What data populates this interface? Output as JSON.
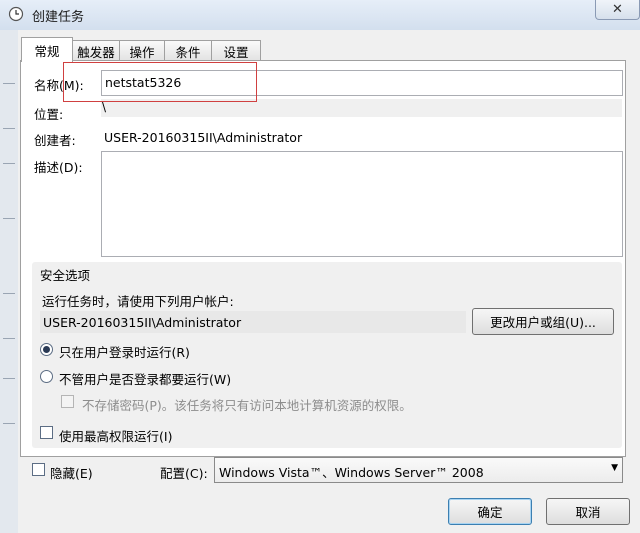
{
  "window": {
    "title": "创建任务",
    "close_glyph": "✕"
  },
  "tabs": [
    {
      "label": "常规",
      "active": true
    },
    {
      "label": "触发器"
    },
    {
      "label": "操作"
    },
    {
      "label": "条件"
    },
    {
      "label": "设置"
    }
  ],
  "general": {
    "name_label": "名称(M):",
    "name_value": "netstat5326",
    "location_label": "位置:",
    "location_value": "\\",
    "author_label": "创建者:",
    "author_value": "USER-20160315II\\Administrator",
    "description_label": "描述(D):",
    "description_value": ""
  },
  "security": {
    "group_title": "安全选项",
    "run_as_prompt": "运行任务时，请使用下列用户帐户:",
    "user_account": "USER-20160315II\\Administrator",
    "change_user_button": "更改用户或组(U)...",
    "option_logged_on": "只在用户登录时运行(R)",
    "option_logged_on_selected": true,
    "option_whether_logged": "不管用户是否登录都要运行(W)",
    "no_store_password": "不存储密码(P)。该任务将只有访问本地计算机资源的权限。",
    "highest_privileges": "使用最高权限运行(I)"
  },
  "footer": {
    "hidden_label": "隐藏(E)",
    "configure_label": "配置(C):",
    "configure_value": "Windows Vista™、Windows Server™ 2008",
    "ok_button": "确定",
    "cancel_button": "取消"
  },
  "icons": {
    "window_icon": "clock-icon",
    "dropdown_arrow": "▼"
  }
}
